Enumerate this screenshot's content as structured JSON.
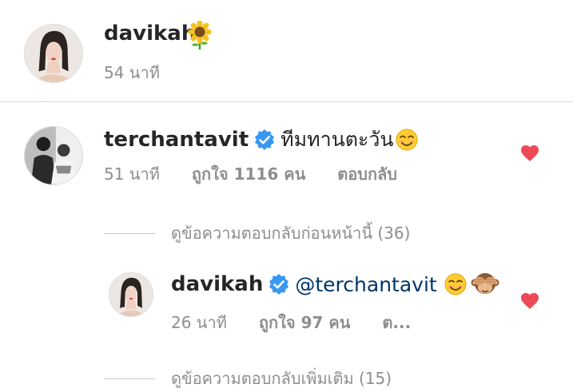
{
  "caption": {
    "username": "davikah",
    "emoji": "sunflower",
    "time": "54 นาที"
  },
  "comments": [
    {
      "username": "terchantavit",
      "verified": true,
      "text": "ทีมทานตะวัน",
      "emoji": "smiling-face",
      "time": "51 นาที",
      "likes": "ถูกใจ 1116 คน",
      "reply": "ตอบกลับ",
      "liked": true
    }
  ],
  "view_previous_replies": "ดูข้อความตอบกลับก่อนหน้านี้ (36)",
  "reply": {
    "username": "davikah",
    "verified": true,
    "mention": "@terchantavit",
    "emojis": [
      "smiling-face",
      "see-no-evil-monkey"
    ],
    "time": "26 นาที",
    "likes": "ถูกใจ 97 คน",
    "reply": "ต...",
    "liked": true
  },
  "view_more_replies": "ดูข้อความตอบกลับเพิ่มเติม (15)",
  "colors": {
    "heart": "#ed4956",
    "verified": "#3897f0",
    "mention": "#003569",
    "meta": "#8e8e8e"
  }
}
